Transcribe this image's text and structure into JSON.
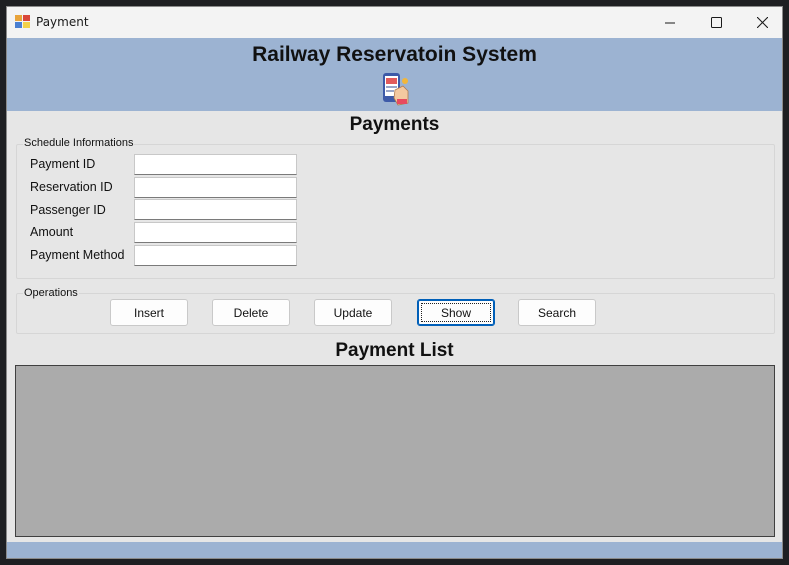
{
  "window": {
    "title": "Payment",
    "controls": {
      "minimize": "minimize-icon",
      "maximize": "maximize-icon",
      "close": "close-icon"
    }
  },
  "banner": {
    "title": "Railway Reservatoin System",
    "logo": "payment-phone-icon",
    "background": "#9cb3d2"
  },
  "payments": {
    "heading": "Payments",
    "group_label": "Schedule Informations",
    "fields": [
      {
        "label": "Payment ID",
        "value": ""
      },
      {
        "label": "Reservation ID",
        "value": ""
      },
      {
        "label": "Passenger ID",
        "value": ""
      },
      {
        "label": "Amount",
        "value": ""
      },
      {
        "label": "Payment Method",
        "value": ""
      }
    ]
  },
  "operations": {
    "group_label": "Operations",
    "buttons": [
      "Insert",
      "Delete",
      "Update",
      "Show",
      "Search"
    ],
    "focused": "Show"
  },
  "payment_list": {
    "heading": "Payment List",
    "rows": []
  },
  "colors": {
    "accent": "#9cb3d2",
    "grid_background": "#ababab",
    "focus": "#005fb8"
  }
}
